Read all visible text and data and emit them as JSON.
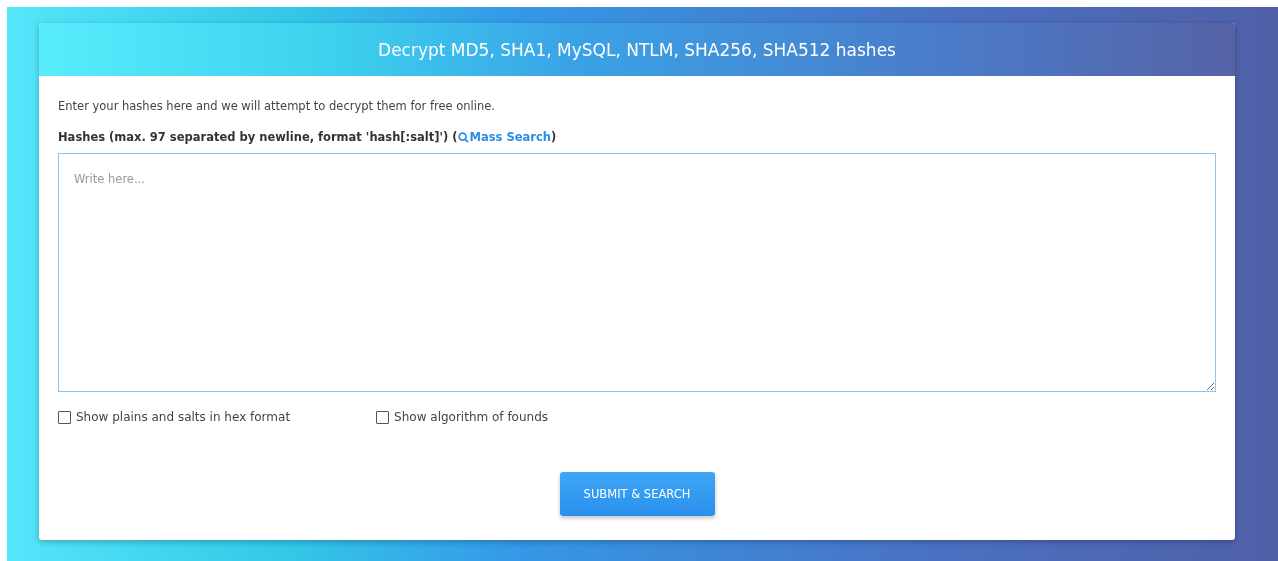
{
  "header": {
    "title": "Decrypt MD5, SHA1, MySQL, NTLM, SHA256, SHA512 hashes"
  },
  "intro": "Enter your hashes here and we will attempt to decrypt them for free online.",
  "hashes_label": {
    "text": "Hashes (max. 97 separated by newline, format 'hash[:salt]') (",
    "link": "Mass Search",
    "close": ")"
  },
  "hashes_field": {
    "placeholder": "Write here..."
  },
  "options": [
    {
      "label": "Show plains and salts in hex format",
      "checked": false
    },
    {
      "label": "Show algorithm of founds",
      "checked": false
    }
  ],
  "submit_button": "SUBMIT & SEARCH"
}
